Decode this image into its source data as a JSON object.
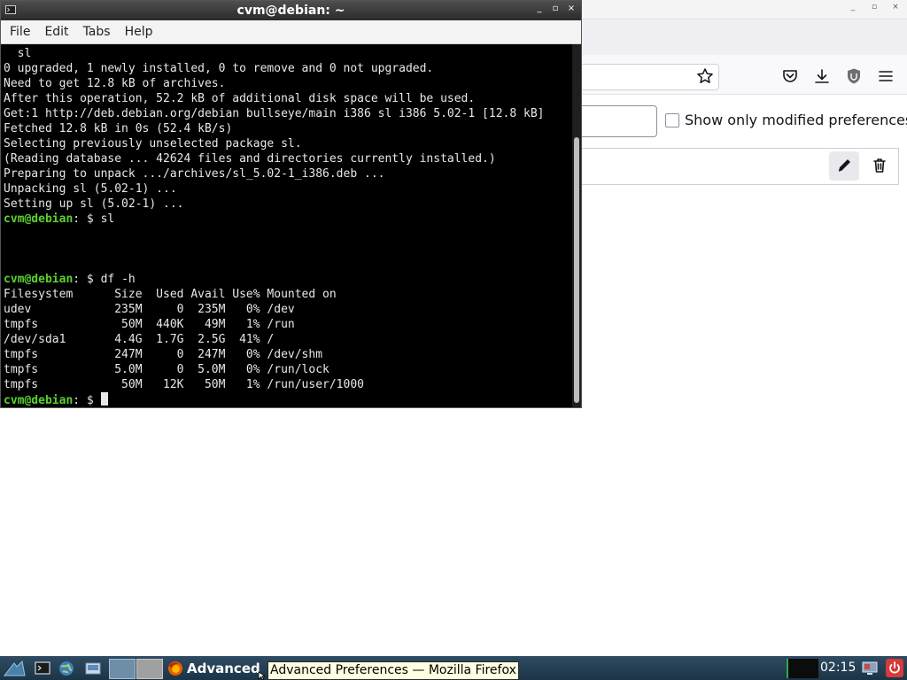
{
  "firefox": {
    "checkbox_label": "Show only modified preferences",
    "wm_min": "_",
    "wm_max": "▫",
    "wm_close": "×"
  },
  "terminal": {
    "title": "cvm@debian: ~",
    "wm_min": "_",
    "wm_max": "▫",
    "wm_close": "×",
    "menu": [
      "File",
      "Edit",
      "Tabs",
      "Help"
    ],
    "lines": [
      {
        "type": "out",
        "text": "  sl"
      },
      {
        "type": "out",
        "text": "0 upgraded, 1 newly installed, 0 to remove and 0 not upgraded."
      },
      {
        "type": "out",
        "text": "Need to get 12.8 kB of archives."
      },
      {
        "type": "out",
        "text": "After this operation, 52.2 kB of additional disk space will be used."
      },
      {
        "type": "out",
        "text": "Get:1 http://deb.debian.org/debian bullseye/main i386 sl i386 5.02-1 [12.8 kB]"
      },
      {
        "type": "out",
        "text": "Fetched 12.8 kB in 0s (52.4 kB/s)"
      },
      {
        "type": "out",
        "text": "Selecting previously unselected package sl."
      },
      {
        "type": "out",
        "text": "(Reading database ... 42624 files and directories currently installed.)"
      },
      {
        "type": "out",
        "text": "Preparing to unpack .../archives/sl_5.02-1_i386.deb ..."
      },
      {
        "type": "out",
        "text": "Unpacking sl (5.02-1) ..."
      },
      {
        "type": "out",
        "text": "Setting up sl (5.02-1) ..."
      },
      {
        "type": "prompt",
        "user": "cvm@debian",
        "rest": ": $ ",
        "cmd": "sl"
      },
      {
        "type": "out",
        "text": ""
      },
      {
        "type": "out",
        "text": ""
      },
      {
        "type": "out",
        "text": ""
      },
      {
        "type": "prompt",
        "user": "cvm@debian",
        "rest": ": $ ",
        "cmd": "df -h"
      },
      {
        "type": "out",
        "text": "Filesystem      Size  Used Avail Use% Mounted on"
      },
      {
        "type": "out",
        "text": "udev            235M     0  235M   0% /dev"
      },
      {
        "type": "out",
        "text": "tmpfs            50M  440K   49M   1% /run"
      },
      {
        "type": "out",
        "text": "/dev/sda1       4.4G  1.7G  2.5G  41% /"
      },
      {
        "type": "out",
        "text": "tmpfs           247M     0  247M   0% /dev/shm"
      },
      {
        "type": "out",
        "text": "tmpfs           5.0M     0  5.0M   0% /run/lock"
      },
      {
        "type": "out",
        "text": "tmpfs            50M   12K   50M   1% /run/user/1000"
      },
      {
        "type": "prompt",
        "user": "cvm@debian",
        "rest": ": $ ",
        "cmd": "",
        "cursor": true
      }
    ]
  },
  "taskbar": {
    "task_label": "Advanced Preferences — Mozilla Firefox",
    "tooltip": "Advanced Preferences — Mozilla Firefox",
    "clock": "02:15"
  },
  "colors": {
    "prompt_user": "#5bd12f",
    "terminal_bg": "#000000",
    "taskbar": "#1c3447",
    "tooltip_bg": "#ffffe1"
  }
}
